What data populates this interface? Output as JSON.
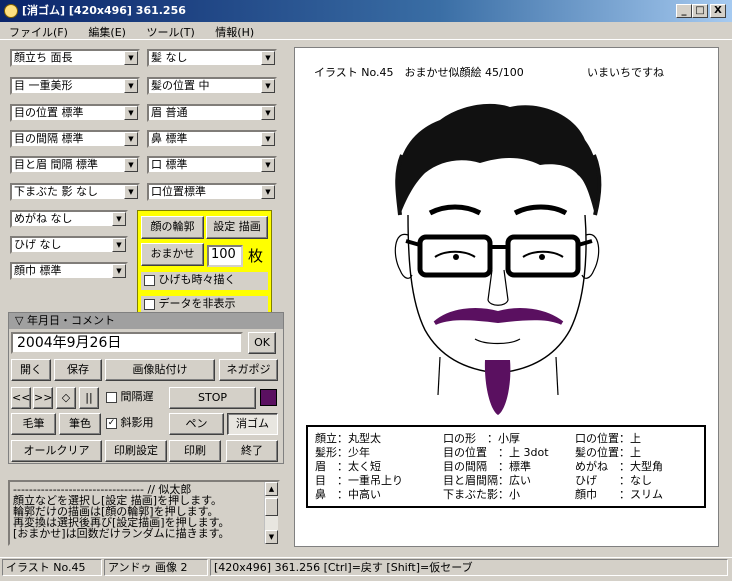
{
  "window": {
    "title": "[消ゴム]  [420x496]  361.256",
    "min": "_",
    "max": "□",
    "close": "X"
  },
  "menu": [
    "ファイル(F)",
    "編集(E)",
    "ツール(T)",
    "情報(H)"
  ],
  "combos": {
    "face_shape": "顔立ち 面長",
    "hair": "髪 なし",
    "eye_shape": "目 一重美形",
    "hair_position": "髪の位置 中",
    "eye_position": "目の位置 標準",
    "eyebrow": "眉 普通",
    "eye_spacing": "目の間隔 標準",
    "nose": "鼻 標準",
    "eye_brow_spacing": "目と眉 間隔 標準",
    "mouth": "口 標準",
    "eyelid_shadow": "下まぶた 影 なし",
    "mouth_position": "口位置標準",
    "glasses": "めがね なし",
    "beard": "ひげ なし",
    "outline": "顔巾 標準"
  },
  "yellow_panel": {
    "outline_button": "顔の輪郭",
    "draw_button": "設定 描画",
    "auto_button": "おまかせ",
    "count_value": "100",
    "count_unit": "枚",
    "beard_checkbox": "ひげも時々描く",
    "hide_data_checkbox": "データを非表示"
  },
  "date_panel": {
    "title": "▽ 年月日・コメント",
    "date_value": "2004年9月26日",
    "ok_button": "OK"
  },
  "buttons": {
    "open": "開く",
    "save": "保存",
    "paste_image": "画像貼付け",
    "negapos": "ネガポジ",
    "prev_prev": "<<",
    "next_next": ">>",
    "diamond": "◇",
    "pause": "||",
    "interval_delay": "間隔遅",
    "stop": "STOP",
    "brush": "毛筆",
    "pencil": "筆色",
    "hatch": "斜影用",
    "pen": "ペン",
    "eraser": "消ゴム",
    "all_clear": "オールクリア",
    "print_setup": "印刷設定",
    "print": "印刷",
    "exit": "終了"
  },
  "accent_color": "#5a1060",
  "memo_lines": [
    "--------------------------------- // 似太郎",
    "顔立などを選択し[設定 描画]を押します。",
    "輪郭だけの描画は[顔の輪郭]を押します。",
    "再変換は選択後再び[設定描画]を押します。",
    "[おまかせ]は回数だけランダムに描きます。"
  ],
  "canvas": {
    "caption": "イラスト No.45　おまかせ似顔絵 45/100",
    "remark": "いまいちですね",
    "attributes": [
      [
        "顔立：丸型太",
        "口の形　：小厚",
        "口の位置：上"
      ],
      [
        "髪形：少年",
        "目の位置　：上 3dot",
        "髪の位置：上"
      ],
      [
        "眉　：太く短",
        "目の間隔　：標準",
        "めがね　：大型角"
      ],
      [
        "目　：一重吊上り",
        "目と眉間隔：広い",
        "ひげ　　：なし"
      ],
      [
        "鼻　：中高い",
        "下まぶた影：小",
        "顔巾　　：スリム"
      ]
    ]
  },
  "status": {
    "illust": "イラスト No.45",
    "undo": "アンドゥ 画像 2",
    "info": "[420x496]  361.256  [Ctrl]=戻す [Shift]=仮セーブ"
  }
}
